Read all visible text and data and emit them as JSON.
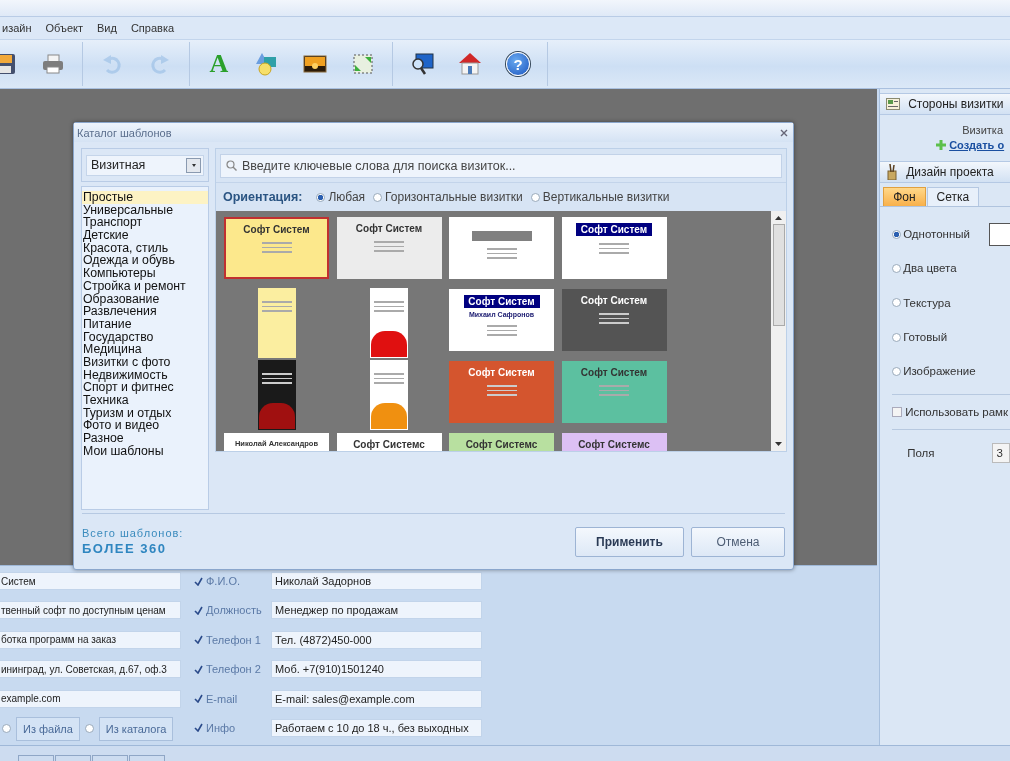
{
  "menu": [
    {
      "label": "изайн"
    },
    {
      "label": "Объект"
    },
    {
      "label": "Вид"
    },
    {
      "label": "Справка"
    }
  ],
  "toolbar": [
    {
      "items": [
        {
          "disabled": false
        },
        {
          "disabled": false
        }
      ]
    },
    {
      "items": [
        {
          "disabled": true
        },
        {
          "disabled": true
        }
      ]
    },
    {
      "items": [
        {
          "disabled": false,
          "glyph": "A"
        },
        {
          "disabled": false
        },
        {
          "disabled": false
        },
        {
          "disabled": false
        }
      ]
    },
    {
      "items": [
        {
          "disabled": false
        },
        {
          "disabled": false
        },
        {
          "disabled": false,
          "glyph": "?"
        }
      ]
    }
  ],
  "dialog": {
    "title": "Каталог шаблонов",
    "category_select": "Визитная",
    "categories": [
      {
        "label": "Простые",
        "selected": true
      },
      {
        "label": "Универсальные",
        "selected": false
      },
      {
        "label": "Транспорт",
        "selected": false
      },
      {
        "label": "Детские",
        "selected": false
      },
      {
        "label": "Красота, стиль",
        "selected": false
      },
      {
        "label": "Одежда и обувь",
        "selected": false
      },
      {
        "label": "Компьютеры",
        "selected": false
      },
      {
        "label": "Стройка и ремонт",
        "selected": false
      },
      {
        "label": "Образование",
        "selected": false
      },
      {
        "label": "Развлечения",
        "selected": false
      },
      {
        "label": "Питание",
        "selected": false
      },
      {
        "label": "Государство",
        "selected": false
      },
      {
        "label": "Медицина",
        "selected": false
      },
      {
        "label": "Визитки с фото",
        "selected": false
      },
      {
        "label": "Недвижимость",
        "selected": false
      },
      {
        "label": "Спорт и фитнес",
        "selected": false
      },
      {
        "label": "Техника",
        "selected": false
      },
      {
        "label": "Туризм и отдых",
        "selected": false
      },
      {
        "label": "Фото и видео",
        "selected": false
      },
      {
        "label": "Разное",
        "selected": false
      },
      {
        "label": "Мои шаблоны",
        "selected": false
      }
    ],
    "search": {
      "placeholder": "Введите ключевые слова для поиска визиток..."
    },
    "orientation": {
      "label": "Ориентация:",
      "options": [
        {
          "label": "Любая",
          "selected": true
        },
        {
          "label": "Горизонтальные визитки",
          "selected": false
        },
        {
          "label": "Вертикальные визитки",
          "selected": false
        }
      ]
    },
    "templates": [
      {
        "kind": "horizontal",
        "color": "#fce88c",
        "title": "Софт Систем",
        "selected": true
      },
      {
        "kind": "horizontal",
        "color": "#ececec",
        "title": "Софт Систем",
        "selected": false
      },
      {
        "kind": "horizontal",
        "color": "#ffffff",
        "selected": false
      },
      {
        "kind": "horizontal",
        "color": "#ffffff",
        "accent": {
          "color": "#000080"
        },
        "title": "Софт Систем",
        "selected": false
      },
      {
        "kind": "vertical",
        "color": "#fbeea0",
        "selected": false
      },
      {
        "kind": "vertical",
        "color": "#ffffff",
        "accent": {
          "color": "#e01010"
        },
        "selected": false
      },
      {
        "kind": "horizontal",
        "color": "#ffffff",
        "accent": {
          "color": "#000080"
        },
        "title": "Софт Систем",
        "subtitle": "Михаил Сафронов",
        "selected": false
      },
      {
        "kind": "horizontal",
        "color": "#545454",
        "title": "Софт Систем",
        "selected": false
      },
      {
        "kind": "vertical",
        "color": "#1a1a1a",
        "accent": {
          "color": "#a01010"
        },
        "selected": false
      },
      {
        "kind": "vertical",
        "color": "#ffffff",
        "accent": {
          "color": "#f09010"
        },
        "selected": false
      },
      {
        "kind": "horizontal",
        "color": "#d4552e",
        "title": "Софт Систем",
        "selected": false
      },
      {
        "kind": "horizontal",
        "color": "#5cc0a0",
        "title": "Софт Систем",
        "selected": false
      },
      {
        "kind": "horizontal",
        "color": "#ffffff",
        "title": "Николай Александров",
        "selected": false
      },
      {
        "kind": "horizontal",
        "color": "#ffffff",
        "title": "Софт Системс",
        "selected": false
      },
      {
        "kind": "horizontal",
        "color": "#b8e0a0",
        "title": "Софт Системс",
        "selected": false
      },
      {
        "kind": "horizontal",
        "color": "#dcc0f4",
        "title": "Софт Системс",
        "selected": false
      }
    ],
    "total_label": "Всего шаблонов:",
    "total_value": "БОЛЕЕ 360",
    "buttons": [
      {
        "label": "Применить",
        "kind": "primary"
      },
      {
        "label": "Отмена",
        "kind": "secondary"
      }
    ]
  },
  "form": {
    "left_fields": [
      {
        "value": "Систем"
      },
      {
        "value": "твенный софт по доступным ценам"
      },
      {
        "value": "ботка программ на заказ"
      },
      {
        "value": "ининград, ул. Советская, д.67, оф.3"
      },
      {
        "value": "example.com"
      }
    ],
    "image_source": [
      {
        "label": "Из файла",
        "selected": false
      },
      {
        "label": "Из каталога",
        "selected": false
      }
    ],
    "fields": [
      {
        "label": "Ф.И.О.",
        "checked": true,
        "value": "Николай Задорнов"
      },
      {
        "label": "Должность",
        "checked": true,
        "value": "Менеджер по продажам"
      },
      {
        "label": "Телефон 1",
        "checked": true,
        "value": "Тел. (4872)450-000"
      },
      {
        "label": "Телефон 2",
        "checked": true,
        "value": "Моб. +7(910)1501240"
      },
      {
        "label": "E-mail",
        "checked": true,
        "value": "E-mail: sales@example.com"
      },
      {
        "label": "Инфо",
        "checked": true,
        "value": "Работаем с 10 до 18 ч., без выходных"
      }
    ]
  },
  "right_panel": {
    "sides_title": "Стороны визитки",
    "side_label": "Визитка",
    "create_link": "Создать о",
    "design_title": "Дизайн проекта",
    "tabs": [
      {
        "label": "Фон",
        "selected": true
      },
      {
        "label": "Сетка",
        "selected": false
      }
    ],
    "fill_options": [
      {
        "label": "Однотонный",
        "selected": true
      },
      {
        "label": "Два цвета",
        "selected": false
      },
      {
        "label": "Текстура",
        "selected": false
      },
      {
        "label": "Готовый",
        "selected": false
      },
      {
        "label": "Изображение",
        "selected": false
      }
    ],
    "use_frame": {
      "label": "Использовать рамк",
      "checked": false
    },
    "margins": {
      "label": "Поля",
      "value": "3"
    }
  }
}
